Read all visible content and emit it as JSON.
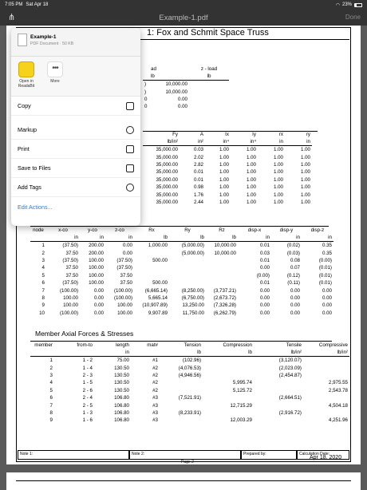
{
  "status": {
    "time": "7:05 PM",
    "date": "Sat Apr 18",
    "battery": "23%"
  },
  "nav": {
    "title": "Example-1.pdf",
    "done": "Done",
    "share_glyph": "⋔"
  },
  "doc_title": "1: Fox and Schmit Space Truss",
  "load_table": {
    "header": [
      "",
      "ad",
      "z - load"
    ],
    "units": [
      "",
      "lb",
      "lb"
    ],
    "rows": [
      [
        ")",
        "10,000.00",
        ""
      ],
      [
        ")",
        "10,000.00",
        ""
      ],
      [
        "0",
        "0.00",
        ""
      ],
      [
        "0",
        "0.00",
        ""
      ]
    ],
    "col2": [
      "10,000.00",
      "10,000.00",
      "0.00",
      "0.00"
    ],
    "col1": [
      ")",
      ")",
      "0",
      "0"
    ]
  },
  "prop_table": {
    "header": [
      "Fy",
      "A",
      "Ix",
      "Iy",
      "rx",
      "ry"
    ],
    "units": [
      "lb/in²",
      "in²",
      "in⁴",
      "in⁴",
      "in",
      "in"
    ],
    "rows": [
      [
        "35,000.00",
        "0.03",
        "1.00",
        "1.00",
        "1.00",
        "1.00"
      ],
      [
        "35,000.00",
        "2.02",
        "1.00",
        "1.00",
        "1.00",
        "1.00"
      ],
      [
        "35,000.00",
        "2.82",
        "1.00",
        "1.00",
        "1.00",
        "1.00"
      ],
      [
        "35,000.00",
        "0.01",
        "1.00",
        "1.00",
        "1.00",
        "1.00"
      ],
      [
        "35,000.00",
        "0.01",
        "1.00",
        "1.00",
        "1.00",
        "1.00"
      ],
      [
        "35,000.00",
        "0.98",
        "1.00",
        "1.00",
        "1.00",
        "1.00"
      ],
      [
        "35,000.00",
        "1.76",
        "1.00",
        "1.00",
        "1.00",
        "1.00"
      ],
      [
        "35,000.00",
        "2.44",
        "1.00",
        "1.00",
        "1.00",
        "1.00"
      ]
    ]
  },
  "node_table": {
    "header": [
      "node",
      "x-co",
      "y-co",
      "z-co",
      "Rx",
      "Ry",
      "Rz",
      "disp-x",
      "disp-y",
      "disp-z"
    ],
    "units": [
      "",
      "in",
      "in",
      "in",
      "lb",
      "lb",
      "lb",
      "in",
      "in",
      "in"
    ],
    "rows": [
      [
        "1",
        "(37.50)",
        "200.00",
        "0.00",
        "1,000.00",
        "(5,000.00)",
        "10,000.00",
        "0.01",
        "(0.02)",
        "0.35"
      ],
      [
        "2",
        "37.50",
        "200.00",
        "0.00",
        "",
        "(5,000.00)",
        "10,000.00",
        "0.03",
        "(0.03)",
        "0.35"
      ],
      [
        "3",
        "(37.50)",
        "100.00",
        "(37.50)",
        "500.00",
        "",
        "",
        "0.01",
        "0.08",
        "(0.00)"
      ],
      [
        "4",
        "37.50",
        "100.00",
        "(37.50)",
        "",
        "",
        "",
        "0.00",
        "0.07",
        "(0.01)"
      ],
      [
        "5",
        "37.50",
        "100.00",
        "37.50",
        "",
        "",
        "",
        "(0.00)",
        "(0.12)",
        "(0.01)"
      ],
      [
        "6",
        "(37.50)",
        "100.00",
        "37.50",
        "500.00",
        "",
        "",
        "0.01",
        "(0.11)",
        "(0.01)"
      ],
      [
        "7",
        "(100.00)",
        "0.00",
        "(100.00)",
        "(6,665.14)",
        "(8,250.00)",
        "(3,737.21)",
        "0.00",
        "0.00",
        "0.00"
      ],
      [
        "8",
        "100.00",
        "0.00",
        "(100.00)",
        "5,665.14",
        "(6,750.00)",
        "(2,673.72)",
        "0.00",
        "0.00",
        "0.00"
      ],
      [
        "9",
        "100.00",
        "0.00",
        "100.00",
        "(10,907.89)",
        "13,250.00",
        "(7,326.28)",
        "0.00",
        "0.00",
        "0.00"
      ],
      [
        "10",
        "(100.00)",
        "0.00",
        "100.00",
        "9,907.89",
        "11,750.00",
        "(6,262.79)",
        "0.00",
        "0.00",
        "0.00"
      ]
    ]
  },
  "member_title": "Member Axial Forces & Stresses",
  "member_table": {
    "header": [
      "member",
      "from-to",
      "length",
      "mat#",
      "Tension",
      "Compression",
      "Tensile",
      "Compressive"
    ],
    "units": [
      "",
      "",
      "in",
      "",
      "lb",
      "lb",
      "lb/in²",
      "lb/in²"
    ],
    "rows": [
      [
        "1",
        "1 - 2",
        "75.00",
        "#1",
        "(102.96)",
        "",
        "(3,120.07)",
        ""
      ],
      [
        "2",
        "1 - 4",
        "130.50",
        "#2",
        "(4,076.53)",
        "",
        "(2,023.09)",
        ""
      ],
      [
        "3",
        "2 - 3",
        "130.50",
        "#2",
        "(4,946.56)",
        "",
        "(2,454.87)",
        ""
      ],
      [
        "4",
        "1 - 5",
        "130.50",
        "#2",
        "",
        "5,995.74",
        "",
        "2,975.55"
      ],
      [
        "5",
        "2 - 6",
        "130.50",
        "#2",
        "",
        "5,125.72",
        "",
        "2,543.78"
      ],
      [
        "6",
        "2 - 4",
        "106.80",
        "#3",
        "(7,521.91)",
        "",
        "(2,664.51)",
        ""
      ],
      [
        "7",
        "2 - 5",
        "106.80",
        "#3",
        "",
        "12,715.29",
        "",
        "4,504.18"
      ],
      [
        "8",
        "1 - 3",
        "106.80",
        "#3",
        "(8,233.91)",
        "",
        "(2,916.72)",
        ""
      ],
      [
        "9",
        "1 - 6",
        "106.80",
        "#3",
        "",
        "12,003.29",
        "",
        "4,251.96"
      ]
    ]
  },
  "footer": {
    "note1": "Note 1:",
    "note2": "Note 2:",
    "prepared": "Prepared by:",
    "calc_label": "Calculation Date:",
    "calc_date": "Apr 18, 2020",
    "page": "Page 2"
  },
  "share_sheet": {
    "file_name": "Example-1",
    "file_info": "PDF Document · 50 KB",
    "apps": [
      {
        "label": "Open in ReadaBit",
        "icon": "readabit-app-icon"
      },
      {
        "label": "More",
        "icon": "more-icon"
      }
    ],
    "actions": [
      {
        "label": "Copy",
        "icon": "copy-icon"
      },
      {
        "label": "Markup",
        "icon": "markup-icon"
      },
      {
        "label": "Print",
        "icon": "print-icon"
      },
      {
        "label": "Save to Files",
        "icon": "folder-icon"
      },
      {
        "label": "Add Tags",
        "icon": "tag-icon"
      }
    ],
    "edit_actions": "Edit Actions..."
  }
}
